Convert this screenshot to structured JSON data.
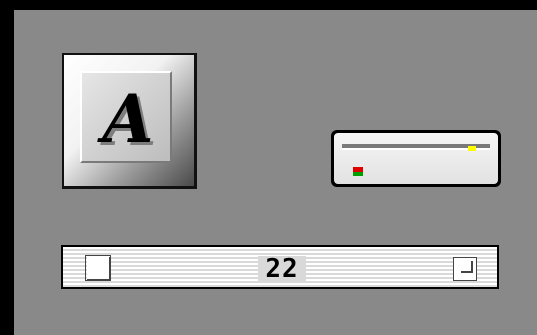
{
  "font_key": {
    "letter": "A",
    "icon": "font-letter-icon"
  },
  "drive": {
    "icon": "drive-icon",
    "led_colors": {
      "busy": "#ffff00",
      "red": "#e00000",
      "green": "#00a000"
    }
  },
  "slider": {
    "value": "22"
  },
  "colors": {
    "background": "#000000",
    "panel": "#898989"
  }
}
